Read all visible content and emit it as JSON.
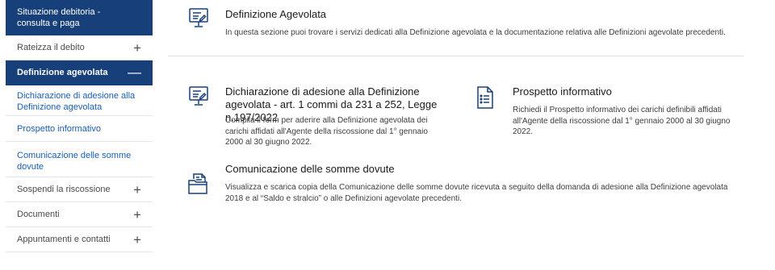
{
  "sidebar": {
    "top_item": {
      "line1": "Situazione debitoria -",
      "line2": "consulta e paga"
    },
    "rateizza": "Rateizza il debito",
    "definizione": "Definizione agevolata",
    "sub_items": [
      "Dichiarazione di adesione alla Definizione agevolata",
      "Prospetto informativo",
      "Comunicazione delle somme dovute"
    ],
    "sospendi": "Sospendi la riscossione",
    "documenti": "Documenti",
    "appuntamenti": "Appuntamenti e contatti",
    "expand_symbol": "+",
    "collapse_symbol": "—"
  },
  "header": {
    "title": "Definizione Agevolata",
    "description": "In questa sezione puoi trovare i servizi dedicati alla Definizione agevolata e la documentazione relativa alle Definizioni agevolate precedenti."
  },
  "cards": {
    "dichiarazione": {
      "title": "Dichiarazione di adesione alla Definizione agevolata - art. 1 commi da 231 a 252, Legge n.197/2022",
      "description": "Compila il form per aderire alla Definizione agevolata dei carichi affidati all'Agente della riscossione dal 1° gennaio 2000 al 30 giugno 2022."
    },
    "prospetto": {
      "title": "Prospetto informativo",
      "description": "Richiedi il Prospetto informativo dei carichi definibili affidati all'Agente della riscossione dal 1° gennaio 2000 al 30 giugno 2022."
    },
    "comunicazione": {
      "title": "Comunicazione delle somme dovute",
      "description": "Visualizza e scarica copia della Comunicazione delle somme dovute ricevuta a seguito della domanda di adesione alla Definizione agevolata 2018 e al “Saldo e stralcio” o alle Definizioni agevolate precedenti."
    }
  },
  "colors": {
    "primary": "#17407a",
    "link": "#1a5fb4"
  }
}
